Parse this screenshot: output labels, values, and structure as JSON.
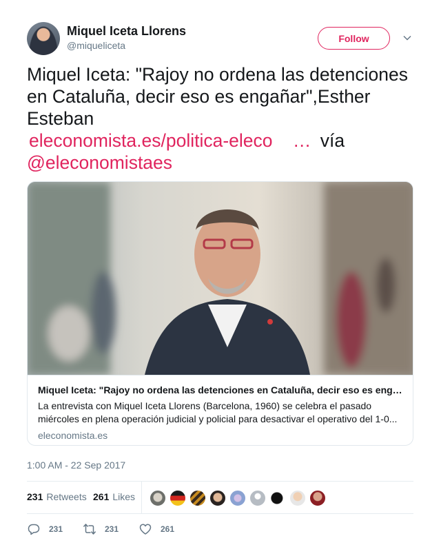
{
  "author": {
    "name": "Miquel Iceta Llorens",
    "handle": "@miqueliceta"
  },
  "follow_label": "Follow",
  "tweet": {
    "text_main": "Miquel Iceta: \"Rajoy no ordena las detenciones en Cataluña, decir eso es engañar\",Esther Esteban",
    "link_text": "eleconomista.es/politica-eleco",
    "link_ellipsis": "…",
    "via": "vía",
    "mention": "@eleconomistaes"
  },
  "card": {
    "title": "Miquel Iceta: \"Rajoy no ordena las detenciones en Cataluña, decir eso es engañar\"",
    "description": "La entrevista con Miquel Iceta Llorens (Barcelona, 1960) se celebra el pasado miércoles en plena operación judicial y policial para desactivar el operativo del 1-0...",
    "domain": "eleconomista.es"
  },
  "timestamp": "1:00 AM - 22 Sep 2017",
  "stats": {
    "retweets_count": "231",
    "retweets_label": "Retweets",
    "likes_count": "261",
    "likes_label": "Likes"
  },
  "actions": {
    "replies": "231",
    "retweets": "231",
    "likes": "261"
  },
  "colors": {
    "accent": "#e0245e",
    "muted": "#657786",
    "text": "#14171a",
    "border": "#e1e8ed"
  },
  "icons": [
    "chevron-down-icon",
    "reply-icon",
    "retweet-icon",
    "heart-icon"
  ]
}
